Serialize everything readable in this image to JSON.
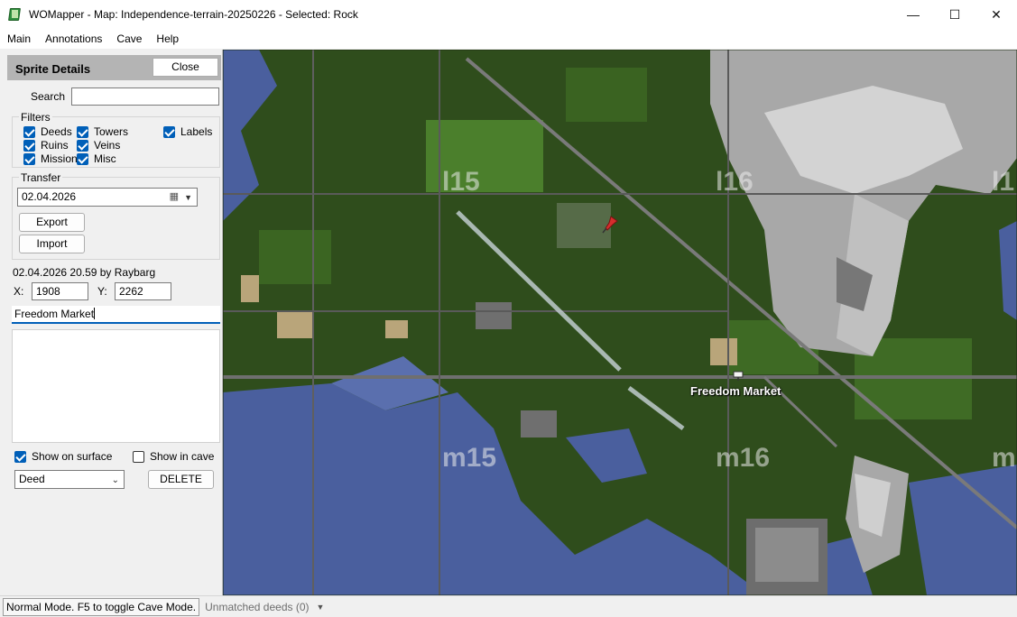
{
  "window": {
    "title": "WOMapper - Map: Independence-terrain-20250226 - Selected: Rock",
    "controls": {
      "minimize": "—",
      "maximize": "☐",
      "close": "✕"
    }
  },
  "menu": [
    "Main",
    "Annotations",
    "Cave",
    "Help"
  ],
  "panel": {
    "title": "Sprite Details",
    "close_label": "Close",
    "search_label": "Search",
    "search_value": "",
    "filters": {
      "legend": "Filters",
      "items": [
        {
          "label": "Deeds",
          "checked": true
        },
        {
          "label": "Towers",
          "checked": true
        },
        {
          "label": "Labels",
          "checked": true
        },
        {
          "label": "Ruins",
          "checked": true
        },
        {
          "label": "Veins",
          "checked": true
        },
        {
          "label": "Mission",
          "checked": true
        },
        {
          "label": "Misc",
          "checked": true
        }
      ]
    },
    "transfer": {
      "legend": "Transfer",
      "date": "02.04.2026",
      "export_label": "Export",
      "import_label": "Import"
    },
    "info": "02.04.2026 20.59 by Raybarg",
    "x_label": "X:",
    "x_value": "1908",
    "y_label": "Y:",
    "y_value": "2262",
    "name_value": "Freedom Market",
    "description": "",
    "show_surface_label": "Show on surface",
    "show_surface_checked": true,
    "show_cave_label": "Show in cave",
    "show_cave_checked": false,
    "type_value": "Deed",
    "delete_label": "DELETE"
  },
  "map": {
    "grid_labels": [
      "l15",
      "l16",
      "l1",
      "m15",
      "m16",
      "m"
    ],
    "marker_label": "Freedom Market",
    "colors": {
      "forest": "#2e4a1b",
      "grass": "#4a7a2a",
      "water": "#4a5f9e",
      "rock": "#a9a9a9",
      "road": "#7a7a7a",
      "sand": "#b9a57a"
    }
  },
  "status": {
    "mode": "Normal Mode. F5 to toggle Cave Mode.",
    "unmatched": "Unmatched deeds (0)"
  }
}
